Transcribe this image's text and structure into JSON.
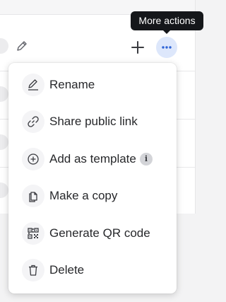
{
  "tooltip": {
    "text": "More actions"
  },
  "toolbar": {
    "edit_icon": "pencil-icon",
    "add_icon": "plus-icon",
    "more_icon": "ellipsis-icon"
  },
  "menu": {
    "items": [
      {
        "label": "Rename",
        "icon": "pencil-underline-icon"
      },
      {
        "label": "Share public link",
        "icon": "link-icon"
      },
      {
        "label": "Add as template",
        "icon": "plus-circle-icon",
        "badge": "i"
      },
      {
        "label": "Make a copy",
        "icon": "copy-file-icon"
      },
      {
        "label": "Generate QR code",
        "icon": "qr-code-icon"
      },
      {
        "label": "Delete",
        "icon": "trash-icon"
      }
    ]
  },
  "colors": {
    "accent": "#2f64d6",
    "accent_soft": "#dde7fb",
    "tooltip_bg": "#15171a",
    "text": "#27282b"
  }
}
